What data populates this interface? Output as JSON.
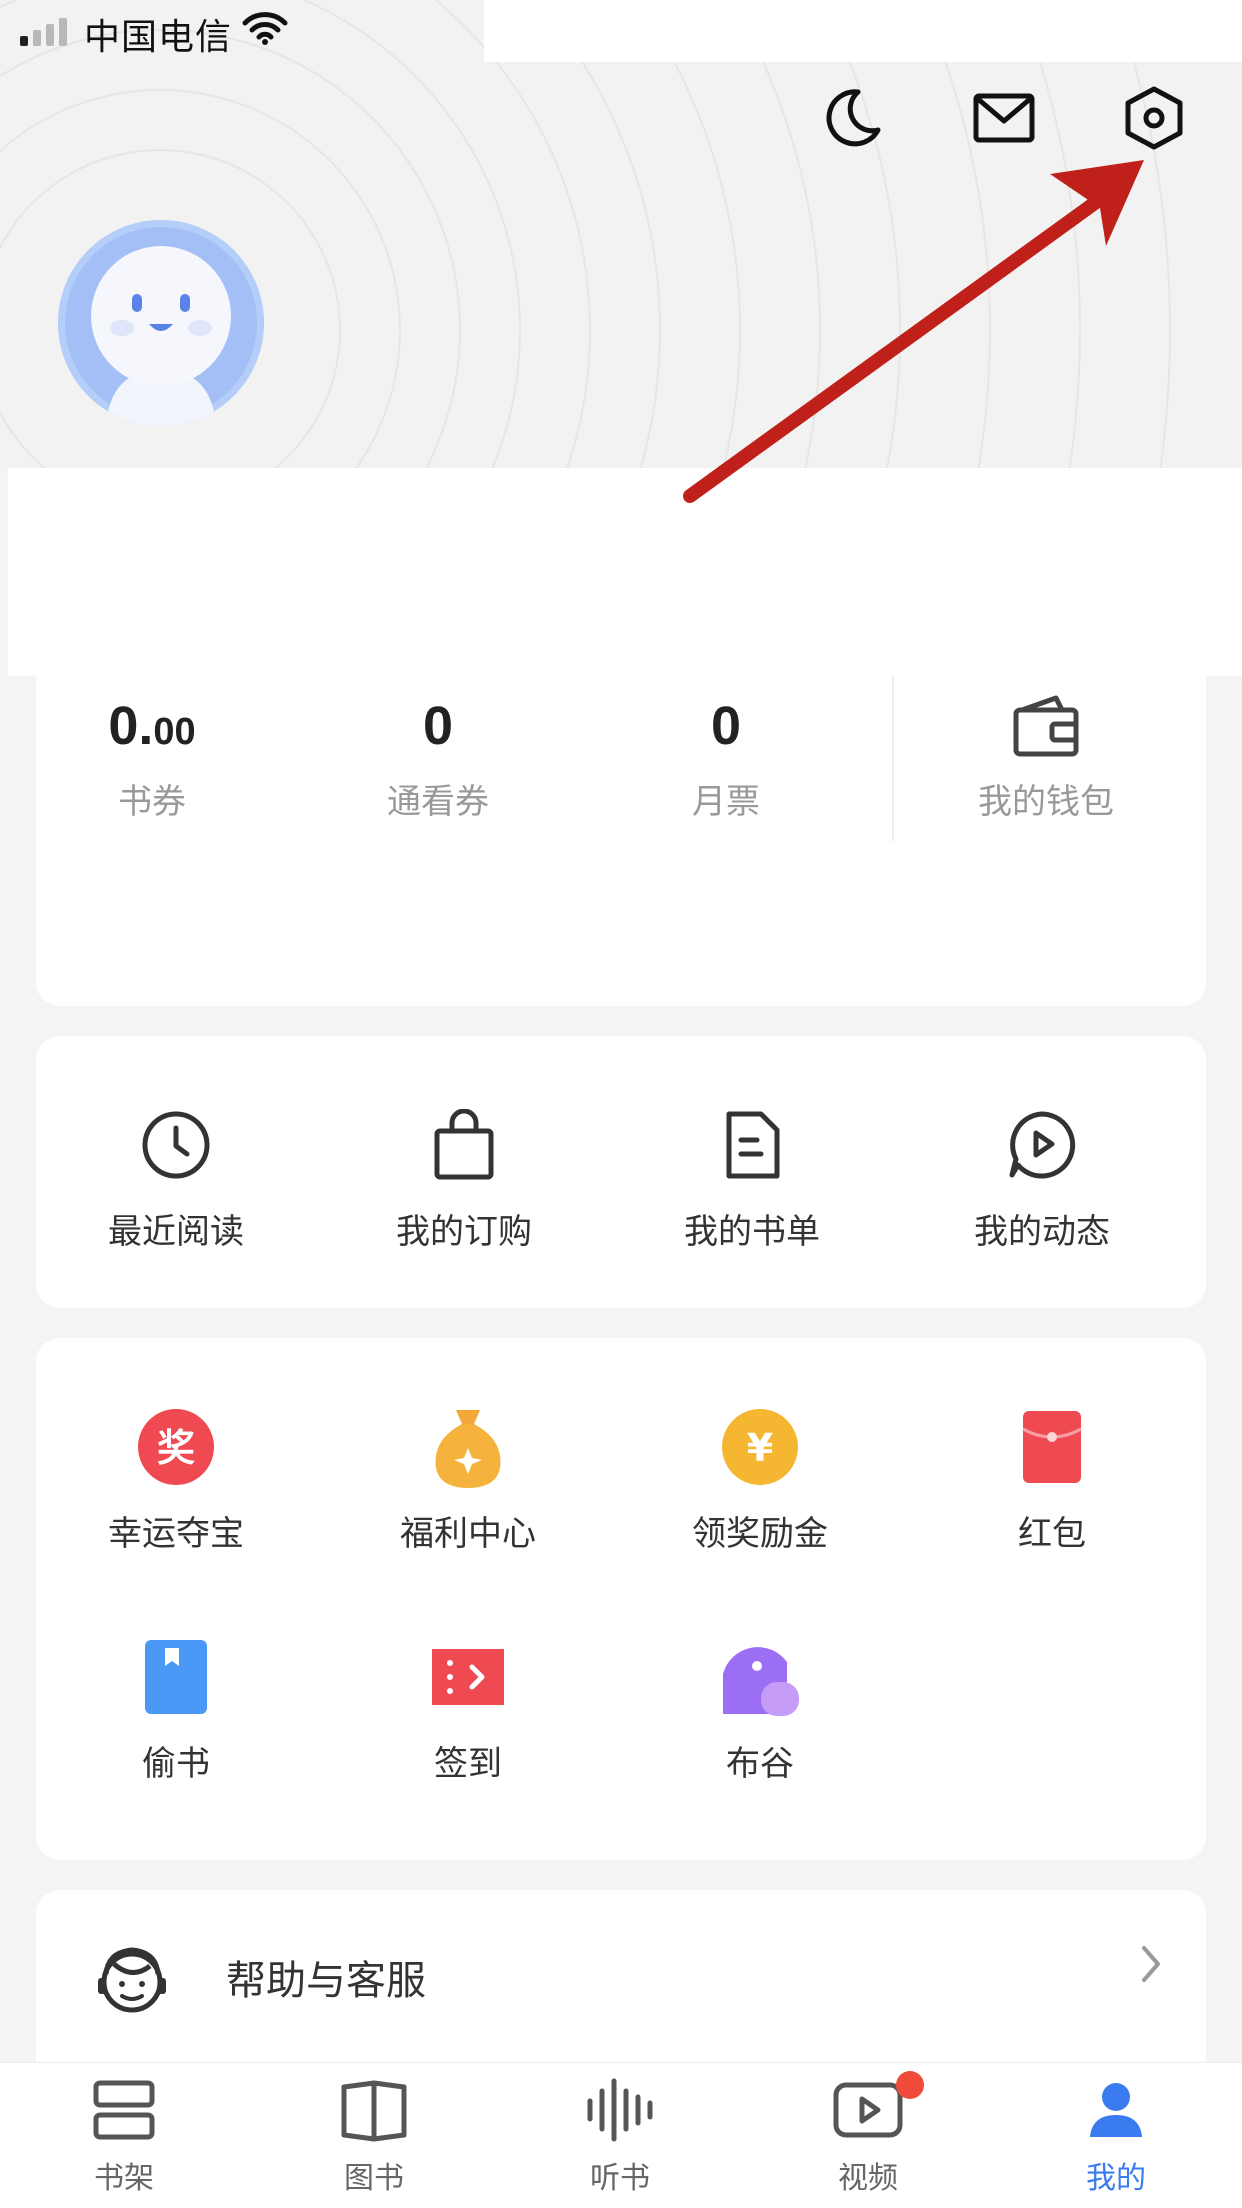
{
  "status_bar": {
    "carrier": "中国电信"
  },
  "header": {
    "night_mode_icon": "moon-icon",
    "message_icon": "mail-icon",
    "settings_icon": "hexagon-gear-icon"
  },
  "stats": {
    "items": [
      {
        "value": "0.",
        "value_small": "00",
        "label": "书券"
      },
      {
        "value": "0",
        "value_small": "",
        "label": "通看券"
      },
      {
        "value": "0",
        "value_small": "",
        "label": "月票"
      }
    ],
    "wallet": {
      "label": "我的钱包",
      "icon": "wallet-icon"
    }
  },
  "quick_actions": [
    {
      "label": "最近阅读",
      "icon": "clock-icon"
    },
    {
      "label": "我的订购",
      "icon": "bag-icon"
    },
    {
      "label": "我的书单",
      "icon": "document-icon"
    },
    {
      "label": "我的动态",
      "icon": "play-bubble-icon"
    }
  ],
  "services": [
    {
      "label": "幸运夺宝",
      "icon": "prize-icon",
      "badge_text": "奖"
    },
    {
      "label": "福利中心",
      "icon": "money-bag-icon"
    },
    {
      "label": "领奖励金",
      "icon": "yen-coin-icon",
      "badge_text": "¥"
    },
    {
      "label": "红包",
      "icon": "red-envelope-icon"
    },
    {
      "label": "偷书",
      "icon": "book-icon"
    },
    {
      "label": "签到",
      "icon": "ticket-icon"
    },
    {
      "label": "布谷",
      "icon": "bird-icon"
    }
  ],
  "help": {
    "label": "帮助与客服",
    "icon": "customer-service-icon"
  },
  "tabs": [
    {
      "label": "书架",
      "icon": "bookshelf-icon"
    },
    {
      "label": "图书",
      "icon": "open-book-icon"
    },
    {
      "label": "听书",
      "icon": "audio-wave-icon"
    },
    {
      "label": "视频",
      "icon": "video-icon"
    },
    {
      "label": "我的",
      "icon": "profile-icon",
      "active": true
    }
  ],
  "colors": {
    "accent": "#3a7bef",
    "arrow": "#c0201a",
    "badge": "#f04a3a"
  }
}
